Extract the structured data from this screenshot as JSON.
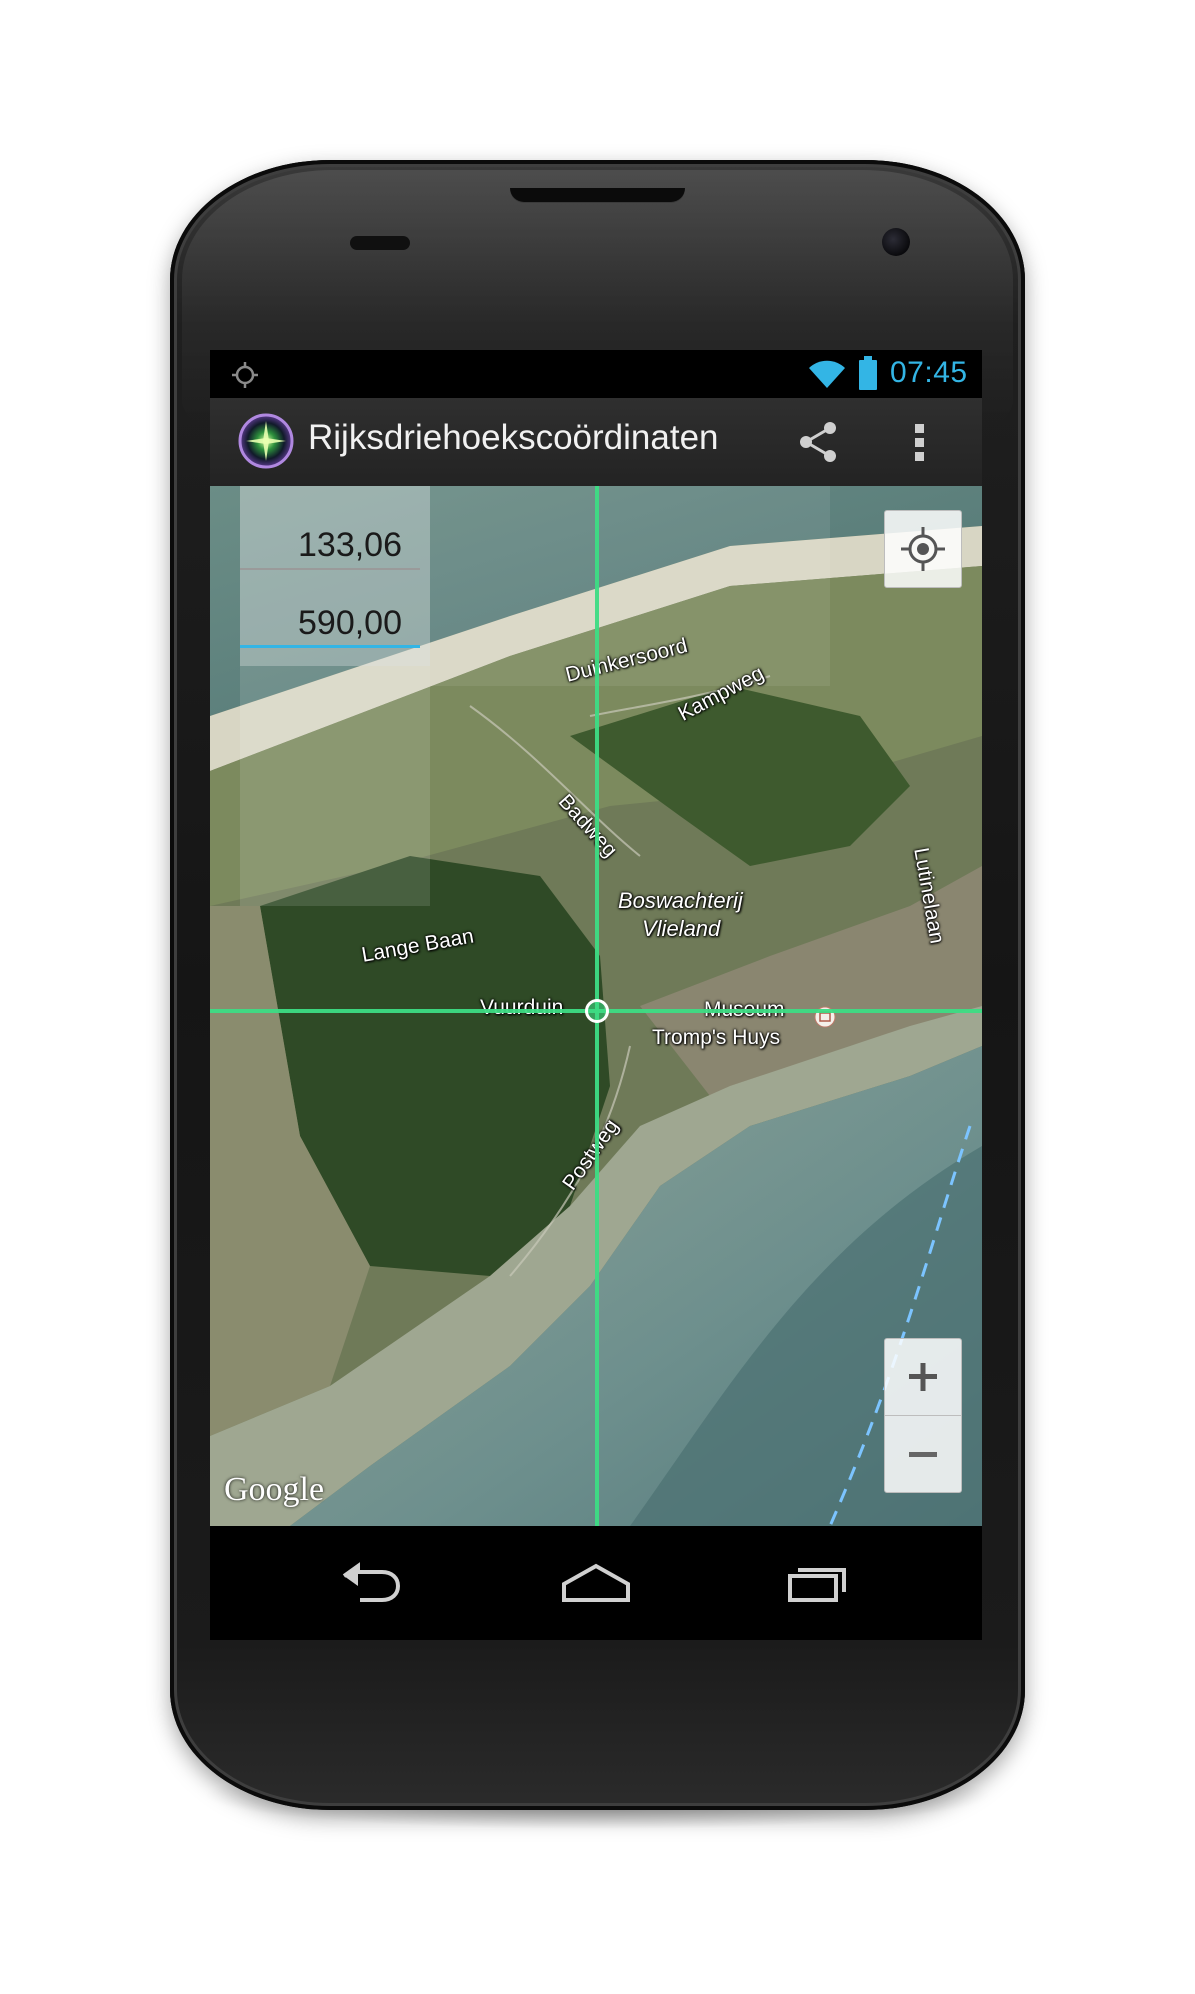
{
  "status_bar": {
    "time": "07:45",
    "icons": [
      "gps-icon",
      "wifi-icon",
      "battery-icon"
    ],
    "accent_color": "#33b5e5"
  },
  "action_bar": {
    "title": "Rijksdriehoekscoördinaten",
    "icons": [
      "app-icon",
      "share-icon",
      "overflow-menu-icon"
    ]
  },
  "coordinates": {
    "x_value": "133,06",
    "y_value": "590,00"
  },
  "map": {
    "labels": {
      "duinkersoord": "Duinkersoord",
      "kampweg": "Kampweg",
      "badweg": "Badweg",
      "boswachterij_line1": "Boswachterij",
      "boswachterij_line2": "Vlieland",
      "lange_baan": "Lange Baan",
      "vuurduin": "Vuurduin",
      "museum_line1": "Museum",
      "museum_line2": "Tromp's Huys",
      "postweg": "Postweg",
      "lutinelaan": "Lutinelaan"
    },
    "attribution": "Google",
    "crosshair_color": "#3ddc84",
    "controls": {
      "my_location": "my-location-icon",
      "zoom_in": "+",
      "zoom_out": "−"
    }
  },
  "nav_bar": {
    "icons": [
      "back-icon",
      "home-icon",
      "recent-apps-icon"
    ]
  }
}
